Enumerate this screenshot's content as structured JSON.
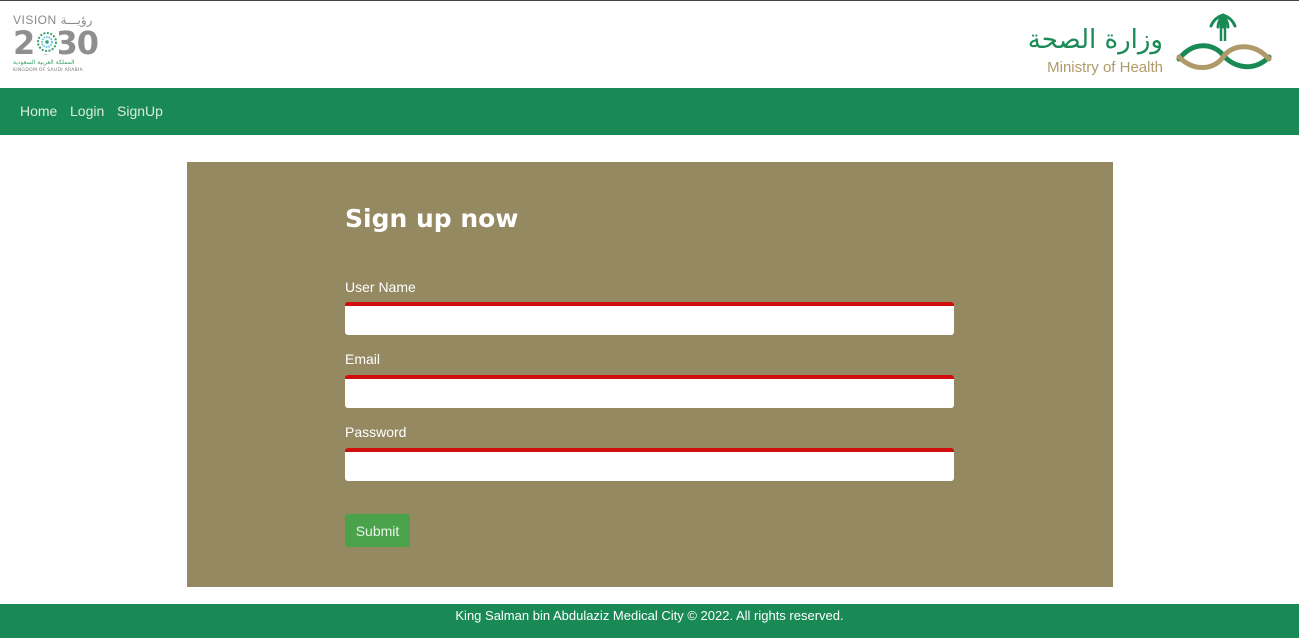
{
  "header": {
    "vision_logo": {
      "top_text": "VISION رؤيـــة",
      "year": "2030",
      "subtitle_ar": "المملكة العربية السعودية",
      "subtitle_en": "KINGDOM OF SAUDI ARABIA"
    },
    "moh_logo": {
      "name_ar": "وزارة الصحة",
      "name_en": "Ministry of Health",
      "icon": "palm-swords-emblem-icon"
    }
  },
  "nav": {
    "items": [
      "Home",
      "Login",
      "SignUp"
    ]
  },
  "form": {
    "title": "Sign up now",
    "fields": [
      {
        "label": "User Name",
        "value": "",
        "placeholder": ""
      },
      {
        "label": "Email",
        "value": "",
        "placeholder": ""
      },
      {
        "label": "Password",
        "value": "",
        "placeholder": ""
      }
    ],
    "submit_label": "Submit"
  },
  "footer": {
    "text": "King Salman bin Abdulaziz Medical City © 2022. All rights reserved."
  },
  "colors": {
    "nav_green": "#198a55",
    "panel_khaki": "#958962",
    "field_error_red": "#d00e0e",
    "submit_green": "#4aa24b"
  }
}
